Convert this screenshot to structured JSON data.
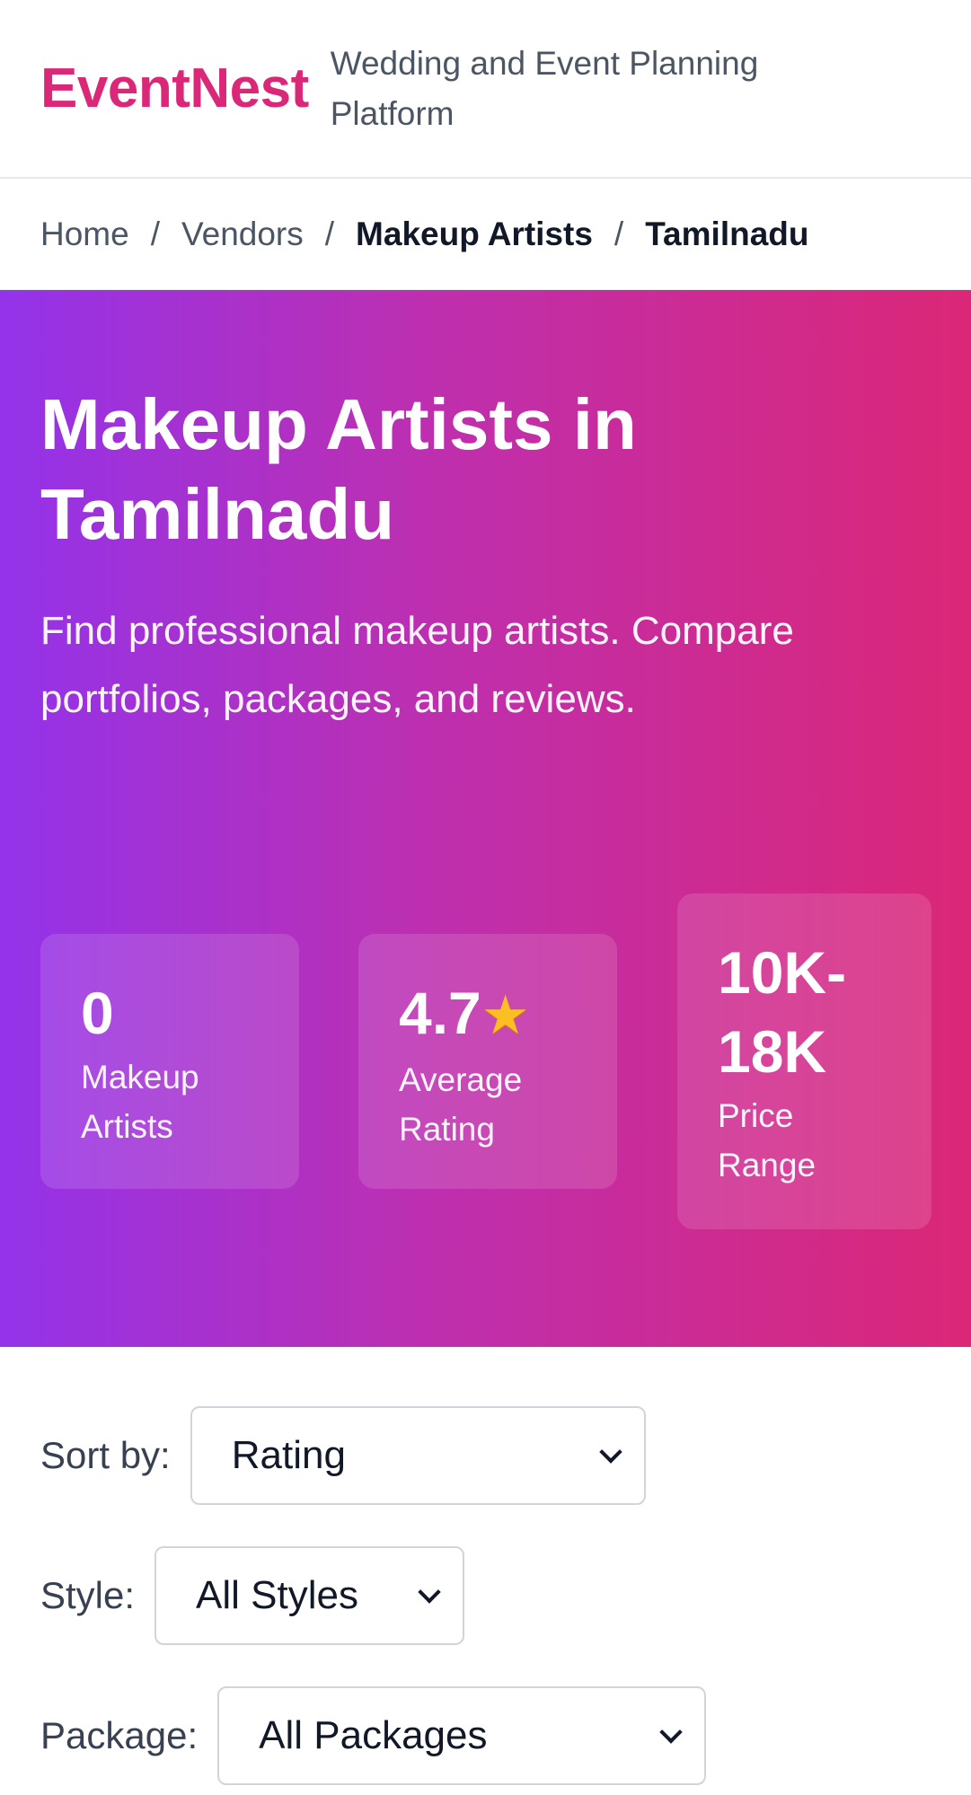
{
  "header": {
    "logo": "EventNest",
    "tagline": "Wedding and Event Planning Platform"
  },
  "breadcrumb": {
    "items": [
      "Home",
      "Vendors",
      "Makeup Artists",
      "Tamilnadu"
    ],
    "separator": "/"
  },
  "hero": {
    "title": "Makeup Artists in Tamilnadu",
    "description": "Find professional makeup artists. Compare portfolios, packages, and reviews.",
    "stats": [
      {
        "value": "0",
        "label": "Makeup Artists"
      },
      {
        "value": "4.7",
        "icon": "star-icon",
        "label": "Average Rating"
      },
      {
        "value": "10K-18K",
        "label": "Price Range"
      }
    ]
  },
  "filters": {
    "sort": {
      "label": "Sort by:",
      "value": "Rating"
    },
    "style": {
      "label": "Style:",
      "value": "All Styles"
    },
    "package": {
      "label": "Package:",
      "value": "All Packages"
    }
  },
  "colors": {
    "brand": "#db2777",
    "gradient_start": "#9333ea",
    "gradient_end": "#db2777"
  }
}
